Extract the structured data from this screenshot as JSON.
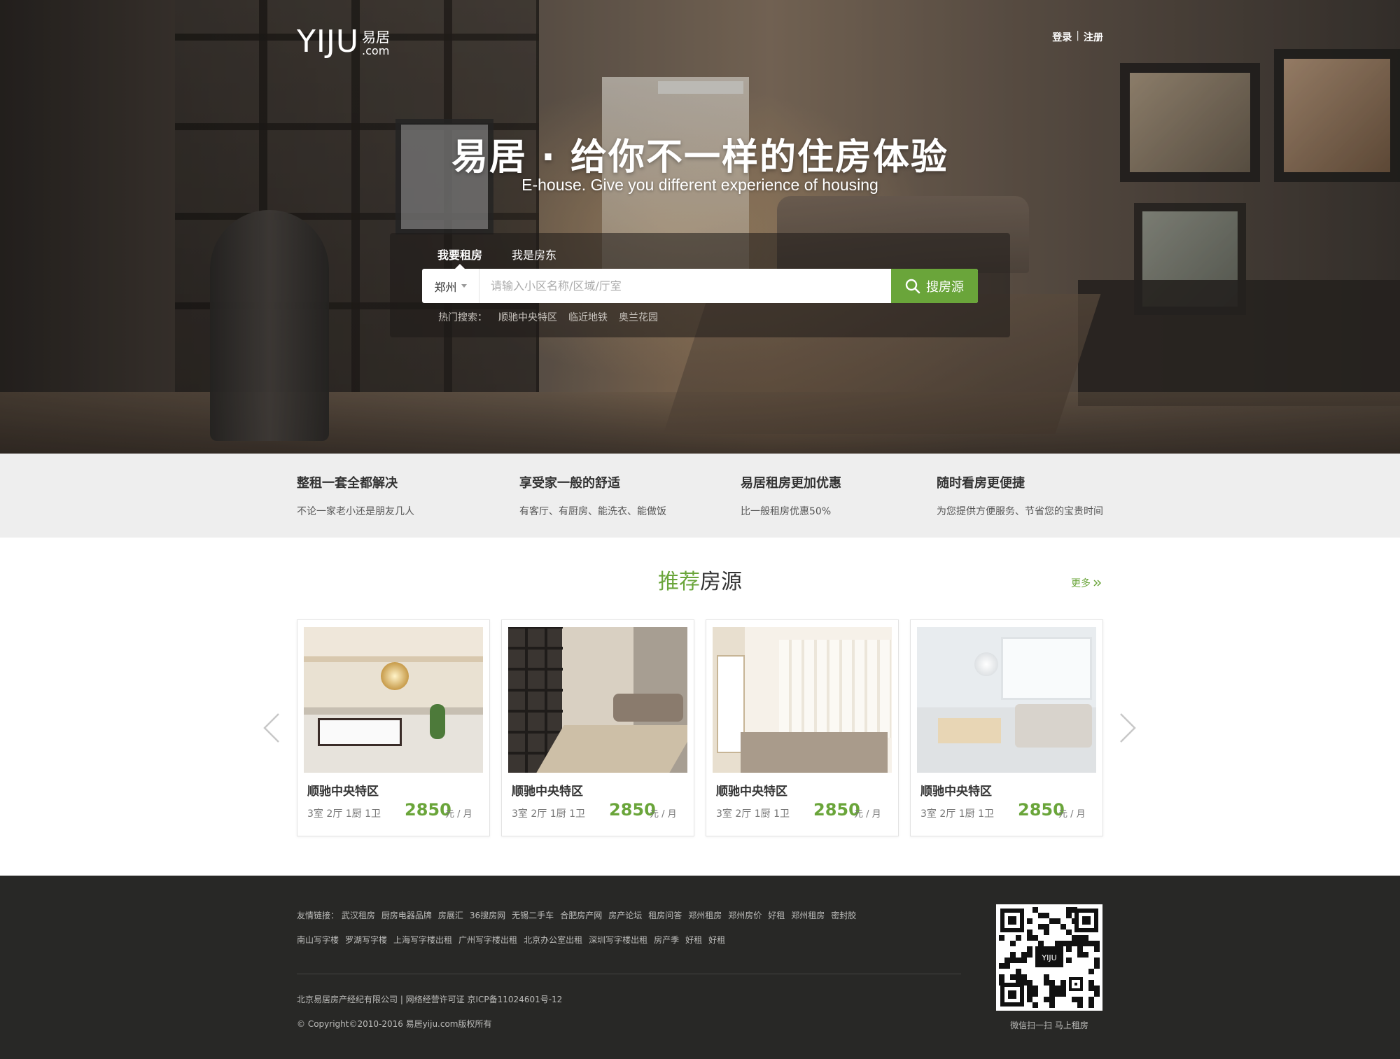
{
  "brand": {
    "logo_main": "YIJU",
    "logo_cn": "易居",
    "logo_com": ".com"
  },
  "auth": {
    "login": "登录",
    "separator": "|",
    "register": "注册"
  },
  "hero": {
    "slogan": "易居 · 给你不一样的住房体验",
    "slogan_en": "E-house. Give you different experience of housing"
  },
  "search": {
    "tabs": [
      {
        "label": "我要租房",
        "active": true
      },
      {
        "label": "我是房东",
        "active": false
      }
    ],
    "city": "郑州",
    "placeholder": "请输入小区名称/区域/厅室",
    "button": "搜房源",
    "hot_label": "热门搜索：",
    "hot_items": [
      "顺驰中央特区",
      "临近地铁",
      "奥兰花园"
    ]
  },
  "features": [
    {
      "title": "整租一套全都解决",
      "desc": "不论一家老小还是朋友几人"
    },
    {
      "title": "享受家一般的舒适",
      "desc": "有客厅、有厨房、能洗衣、能做饭"
    },
    {
      "title": "易居租房更加优惠",
      "desc": "比一般租房优惠50%"
    },
    {
      "title": "随时看房更便捷",
      "desc": "为您提供方便服务、节省您的宝贵时间"
    }
  ],
  "recommend": {
    "title_accent": "推荐",
    "title_rest": "房源",
    "more": "更多",
    "listings": [
      {
        "name": "顺驰中央特区",
        "layout": "3室 2厅 1厨 1卫",
        "price": "2850",
        "unit": "元 / 月"
      },
      {
        "name": "顺驰中央特区",
        "layout": "3室 2厅 1厨 1卫",
        "price": "2850",
        "unit": "元 / 月"
      },
      {
        "name": "顺驰中央特区",
        "layout": "3室 2厅 1厨 1卫",
        "price": "2850",
        "unit": "元 / 月"
      },
      {
        "name": "顺驰中央特区",
        "layout": "3室 2厅 1厨 1卫",
        "price": "2850",
        "unit": "元 / 月"
      }
    ]
  },
  "footer": {
    "links_label": "友情链接：",
    "links_row1": [
      "武汉租房",
      "厨房电器品牌",
      "房展汇",
      "36搜房网",
      "无锡二手车",
      "合肥房产网",
      "房产论坛",
      "租房问答",
      "郑州租房",
      "郑州房价",
      "好租",
      "郑州租房",
      "密封胶"
    ],
    "links_row2": [
      "南山写字楼",
      "罗湖写字楼",
      "上海写字楼出租",
      "广州写字楼出租",
      "北京办公室出租",
      "深圳写字楼出租",
      "房产季",
      "好租",
      "好租"
    ],
    "company": "北京易居房产经纪有限公司 | 网络经营许可证 京ICP备11024601号-12",
    "copyright": "© Copyright©2010-2016 易居yiju.com版权所有",
    "qr_logo": "YIJU",
    "qr_caption": "微信扫一扫 马上租房"
  },
  "colors": {
    "accent": "#6aa53a",
    "footer_bg": "#282826",
    "features_bg": "#eeeeee"
  },
  "icons": {
    "search": "search-icon",
    "more": "double-chevron-right-icon",
    "prev": "chevron-left-icon",
    "next": "chevron-right-icon"
  }
}
